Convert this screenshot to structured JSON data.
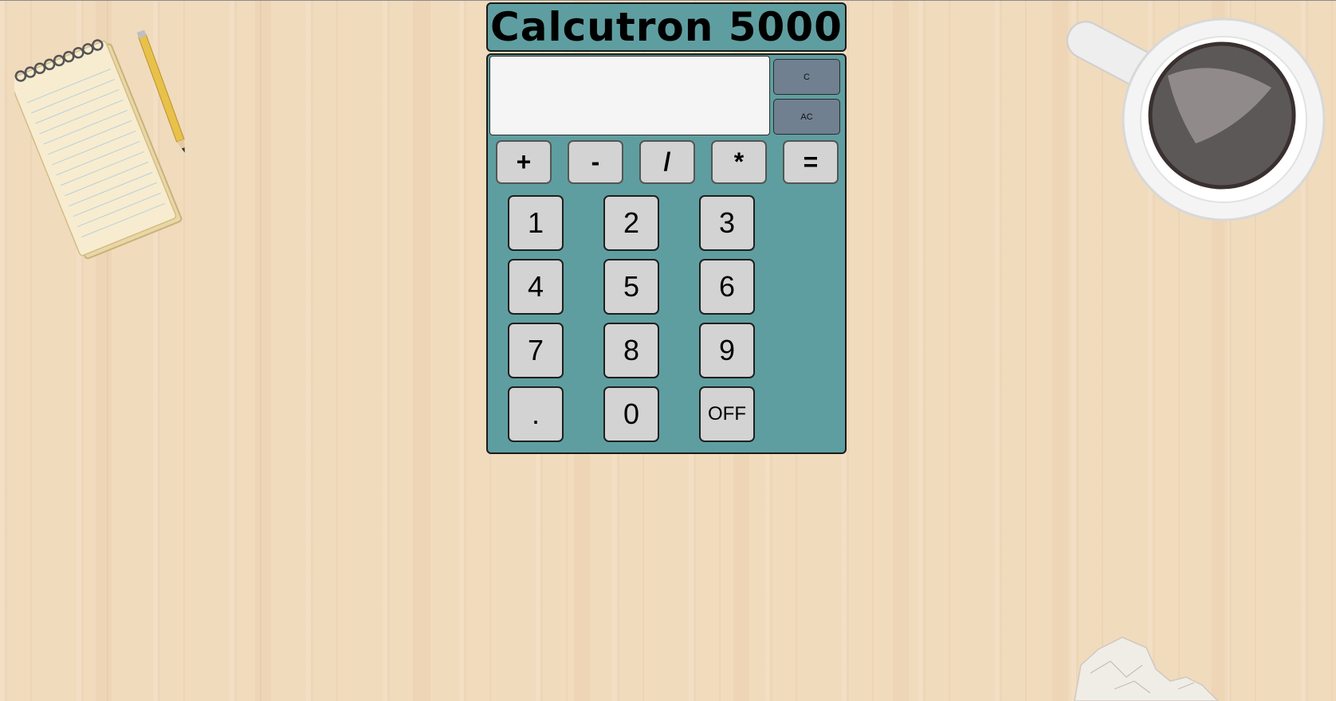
{
  "calculator": {
    "title": "Calcutron 5000",
    "display_value": "",
    "clear_label": "C",
    "all_clear_label": "AC",
    "operators": [
      "+",
      "-",
      "/",
      "*",
      "="
    ],
    "keys": [
      "1",
      "2",
      "3",
      "4",
      "5",
      "6",
      "7",
      "8",
      "9",
      ".",
      "0",
      "OFF"
    ]
  },
  "colors": {
    "body": "#5f9ea0",
    "clear_buttons": "#708090",
    "keys": "#d3d3d3",
    "display": "#f5f5f5",
    "desk": "#f1dbbd"
  },
  "decorations": [
    "notepad-icon",
    "pencil-icon",
    "coffee-cup-icon",
    "crumpled-paper-icon"
  ]
}
